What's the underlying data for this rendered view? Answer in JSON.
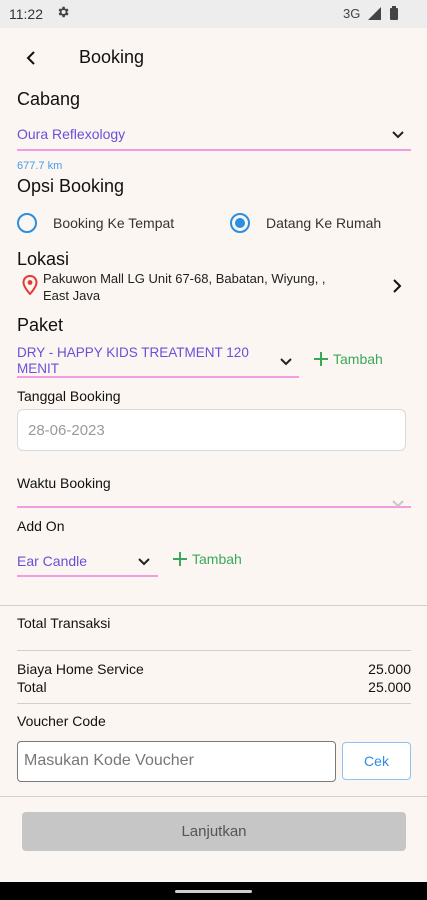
{
  "status_bar": {
    "time": "11:22",
    "network": "3G",
    "icons": [
      "gear-icon",
      "signal-icon",
      "battery-icon"
    ]
  },
  "header": {
    "title": "Booking",
    "back_icon": "back-arrow-icon"
  },
  "cabang": {
    "label": "Cabang",
    "value": "Oura Reflexology",
    "distance": "677.7 km"
  },
  "opsi_booking": {
    "label": "Opsi Booking",
    "options": [
      {
        "label": "Booking Ke Tempat",
        "selected": false
      },
      {
        "label": "Datang Ke Rumah",
        "selected": true
      }
    ]
  },
  "lokasi": {
    "label": "Lokasi",
    "line1": "Pakuwon Mall LG Unit 67-68, Babatan, Wiyung, ,",
    "line2": "East Java"
  },
  "paket": {
    "label": "Paket",
    "line1": "DRY - HAPPY KIDS TREATMENT 120",
    "line2": "MENIT",
    "add_label": "Tambah"
  },
  "tanggal_booking": {
    "label": "Tanggal Booking",
    "value": "28-06-2023"
  },
  "waktu_booking": {
    "label": "Waktu Booking"
  },
  "add_on": {
    "label": "Add On",
    "value": "Ear Candle",
    "add_label": "Tambah"
  },
  "summary": {
    "title": "Total Transaksi",
    "rows": [
      {
        "label": "Biaya Home Service",
        "value": "25.000"
      },
      {
        "label": "Total",
        "value": "25.000"
      }
    ]
  },
  "voucher": {
    "label": "Voucher Code",
    "placeholder": "Masukan Kode Voucher",
    "button": "Cek"
  },
  "footer": {
    "button": "Lanjutkan"
  },
  "colors": {
    "accent_purple": "#6b4fd8",
    "pink_underline": "#f39ce0",
    "radio_blue": "#2b8ee0",
    "green": "#3aa85a",
    "location_red": "#e53935"
  }
}
